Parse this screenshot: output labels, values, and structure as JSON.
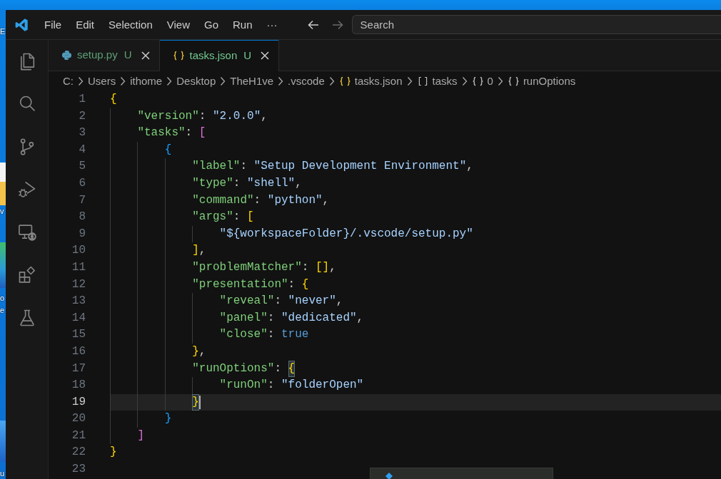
{
  "desktop": {
    "label_fragments": [
      "E",
      "v",
      "o",
      "e",
      "u"
    ]
  },
  "title_bar": {
    "menu": [
      "File",
      "Edit",
      "Selection",
      "View",
      "Go",
      "Run"
    ],
    "more": "···",
    "back": {
      "disabled": false
    },
    "forward": {
      "disabled": true
    },
    "search": {
      "placeholder": "Search"
    }
  },
  "tabs": [
    {
      "kind": "python",
      "label": "setup.py",
      "badge": "U",
      "selected": false
    },
    {
      "kind": "json",
      "label": "tasks.json",
      "badge": "U",
      "selected": true
    }
  ],
  "breadcrumbs": [
    {
      "kind": "folder",
      "text": "C:"
    },
    {
      "kind": "folder",
      "text": "Users"
    },
    {
      "kind": "folder",
      "text": "ithome"
    },
    {
      "kind": "folder",
      "text": "Desktop"
    },
    {
      "kind": "folder",
      "text": "TheH1ve"
    },
    {
      "kind": "folder",
      "text": ".vscode"
    },
    {
      "kind": "file",
      "text": "tasks.json"
    },
    {
      "kind": "array",
      "text": "tasks"
    },
    {
      "kind": "object",
      "text": "0"
    },
    {
      "kind": "object",
      "text": "runOptions"
    }
  ],
  "editor": {
    "lines": [
      {
        "number": "1",
        "current": false,
        "tokens": [
          {
            "kind": "open",
            "text": "{",
            "highlighted": false
          }
        ]
      },
      {
        "number": "2",
        "current": false,
        "tokens": [
          {
            "kind": "key",
            "text": "\"version\""
          },
          {
            "kind": "punct",
            "text": ": "
          },
          {
            "kind": "string",
            "text": "\"2.0.0\""
          },
          {
            "kind": "punct",
            "text": ","
          }
        ]
      },
      {
        "number": "3",
        "current": false,
        "tokens": [
          {
            "kind": "key",
            "text": "\"tasks\""
          },
          {
            "kind": "punct",
            "text": ": "
          },
          {
            "kind": "open",
            "text": "[",
            "highlighted": false
          }
        ]
      },
      {
        "number": "4",
        "current": false,
        "tokens": [
          {
            "kind": "open",
            "text": "{",
            "highlighted": false
          }
        ]
      },
      {
        "number": "5",
        "current": false,
        "tokens": [
          {
            "kind": "key",
            "text": "\"label\""
          },
          {
            "kind": "punct",
            "text": ": "
          },
          {
            "kind": "string",
            "text": "\"Setup Development Environment\""
          },
          {
            "kind": "punct",
            "text": ","
          }
        ]
      },
      {
        "number": "6",
        "current": false,
        "tokens": [
          {
            "kind": "key",
            "text": "\"type\""
          },
          {
            "kind": "punct",
            "text": ": "
          },
          {
            "kind": "string",
            "text": "\"shell\""
          },
          {
            "kind": "punct",
            "text": ","
          }
        ]
      },
      {
        "number": "7",
        "current": false,
        "tokens": [
          {
            "kind": "key",
            "text": "\"command\""
          },
          {
            "kind": "punct",
            "text": ": "
          },
          {
            "kind": "string",
            "text": "\"python\""
          },
          {
            "kind": "punct",
            "text": ","
          }
        ]
      },
      {
        "number": "8",
        "current": false,
        "tokens": [
          {
            "kind": "key",
            "text": "\"args\""
          },
          {
            "kind": "punct",
            "text": ": "
          },
          {
            "kind": "open",
            "text": "[",
            "highlighted": false
          }
        ]
      },
      {
        "number": "9",
        "current": false,
        "tokens": [
          {
            "kind": "string",
            "text": "\"${workspaceFolder}/.vscode/setup.py\""
          }
        ]
      },
      {
        "number": "10",
        "current": false,
        "tokens": [
          {
            "kind": "close",
            "text": "]",
            "highlighted": false
          },
          {
            "kind": "punct",
            "text": ","
          }
        ]
      },
      {
        "number": "11",
        "current": false,
        "tokens": [
          {
            "kind": "key",
            "text": "\"problemMatcher\""
          },
          {
            "kind": "punct",
            "text": ": "
          },
          {
            "kind": "open",
            "text": "[",
            "highlighted": false
          },
          {
            "kind": "close",
            "text": "]",
            "highlighted": false
          },
          {
            "kind": "punct",
            "text": ","
          }
        ]
      },
      {
        "number": "12",
        "current": false,
        "tokens": [
          {
            "kind": "key",
            "text": "\"presentation\""
          },
          {
            "kind": "punct",
            "text": ": "
          },
          {
            "kind": "open",
            "text": "{",
            "highlighted": false
          }
        ]
      },
      {
        "number": "13",
        "current": false,
        "tokens": [
          {
            "kind": "key",
            "text": "\"reveal\""
          },
          {
            "kind": "punct",
            "text": ": "
          },
          {
            "kind": "string",
            "text": "\"never\""
          },
          {
            "kind": "punct",
            "text": ","
          }
        ]
      },
      {
        "number": "14",
        "current": false,
        "tokens": [
          {
            "kind": "key",
            "text": "\"panel\""
          },
          {
            "kind": "punct",
            "text": ": "
          },
          {
            "kind": "string",
            "text": "\"dedicated\""
          },
          {
            "kind": "punct",
            "text": ","
          }
        ]
      },
      {
        "number": "15",
        "current": false,
        "tokens": [
          {
            "kind": "key",
            "text": "\"close\""
          },
          {
            "kind": "punct",
            "text": ": "
          },
          {
            "kind": "keyword",
            "text": "true"
          }
        ]
      },
      {
        "number": "16",
        "current": false,
        "tokens": [
          {
            "kind": "close",
            "text": "}",
            "highlighted": false
          },
          {
            "kind": "punct",
            "text": ","
          }
        ]
      },
      {
        "number": "17",
        "current": false,
        "tokens": [
          {
            "kind": "key",
            "text": "\"runOptions\""
          },
          {
            "kind": "punct",
            "text": ": "
          },
          {
            "kind": "open",
            "text": "{",
            "highlighted": true
          }
        ]
      },
      {
        "number": "18",
        "current": false,
        "tokens": [
          {
            "kind": "key",
            "text": "\"runOn\""
          },
          {
            "kind": "punct",
            "text": ": "
          },
          {
            "kind": "string",
            "text": "\"folderOpen\""
          }
        ]
      },
      {
        "number": "19",
        "current": true,
        "tokens": [
          {
            "kind": "close",
            "text": "}",
            "highlighted": true
          }
        ]
      },
      {
        "number": "20",
        "current": false,
        "tokens": [
          {
            "kind": "close",
            "text": "}",
            "highlighted": false
          }
        ]
      },
      {
        "number": "21",
        "current": false,
        "tokens": [
          {
            "kind": "close",
            "text": "]",
            "highlighted": false
          }
        ]
      },
      {
        "number": "22",
        "current": false,
        "tokens": [
          {
            "kind": "close",
            "text": "}",
            "highlighted": false
          }
        ]
      },
      {
        "number": "23",
        "current": false
      }
    ]
  }
}
